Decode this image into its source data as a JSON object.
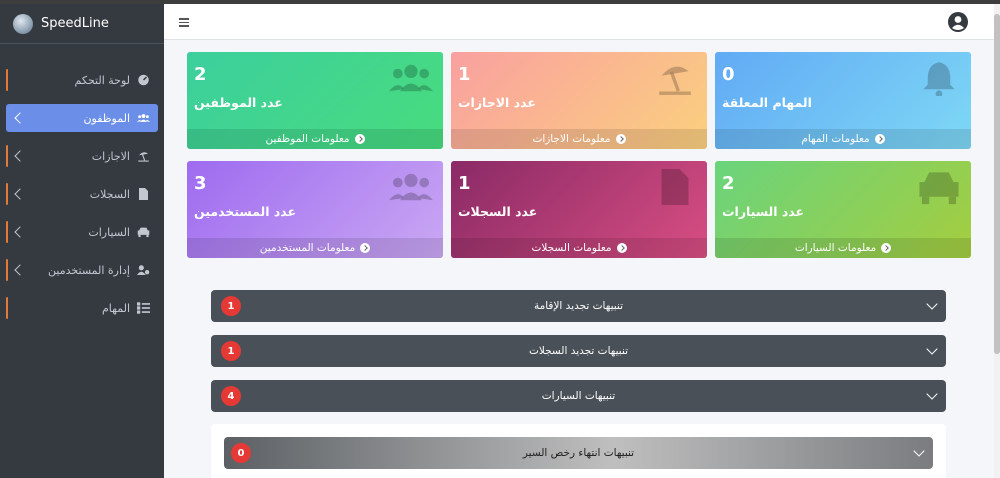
{
  "brand": {
    "name": "SpeedLine"
  },
  "sidebar": {
    "items": [
      {
        "label": "لوحة التحكم",
        "icon": "dashboard-icon",
        "has_arrow": false,
        "active": false
      },
      {
        "label": "الموظفون",
        "icon": "users-icon",
        "has_arrow": true,
        "active": true
      },
      {
        "label": "الاجازات",
        "icon": "umbrella-beach-icon",
        "has_arrow": true,
        "active": false
      },
      {
        "label": "السجلات",
        "icon": "file-icon",
        "has_arrow": true,
        "active": false
      },
      {
        "label": "السيارات",
        "icon": "car-icon",
        "has_arrow": true,
        "active": false
      },
      {
        "label": "إدارة المستخدمين",
        "icon": "user-cog-icon",
        "has_arrow": true,
        "active": false
      },
      {
        "label": "المهام",
        "icon": "tasks-icon",
        "has_arrow": false,
        "active": false
      }
    ]
  },
  "cards": {
    "employees": {
      "count": "2",
      "title": "عدد الموظفين",
      "link": "معلومات الموظفين",
      "icon": "users-icon",
      "color": "#3ccf9d"
    },
    "vacations": {
      "count": "1",
      "title": "عدد الاجازات",
      "link": "معلومات الاجازات",
      "icon": "umbrella-beach-icon",
      "color": "#f9a0a0"
    },
    "tasks": {
      "count": "0",
      "title": "المهام المعلقة",
      "link": "معلومات المهام",
      "icon": "bell-icon",
      "color": "#61aaf5"
    },
    "users": {
      "count": "3",
      "title": "عدد المستخدمين",
      "link": "معلومات المستخدمين",
      "icon": "users-icon",
      "color": "#9e6bf0"
    },
    "records": {
      "count": "1",
      "title": "عدد السجلات",
      "link": "معلومات السجلات",
      "icon": "file-icon",
      "color": "#8a2a66"
    },
    "cars": {
      "count": "2",
      "title": "عدد السيارات",
      "link": "معلومات السيارات",
      "icon": "car-icon",
      "color": "#6ad47c"
    }
  },
  "alerts": [
    {
      "label": "تنبيهات تجديد الإقامة",
      "count": "1"
    },
    {
      "label": "تنبيهات تجديد السجلات",
      "count": "1"
    },
    {
      "label": "تنبيهات  السيارات",
      "count": "4"
    }
  ],
  "sub_alert": {
    "label": "تنبيهات انتهاء رخص السير",
    "count": "0"
  },
  "colors": {
    "sidebar_bg": "#343a40",
    "active_item": "#6b8ee8",
    "badge": "#e53935",
    "accordion": "#495057"
  }
}
